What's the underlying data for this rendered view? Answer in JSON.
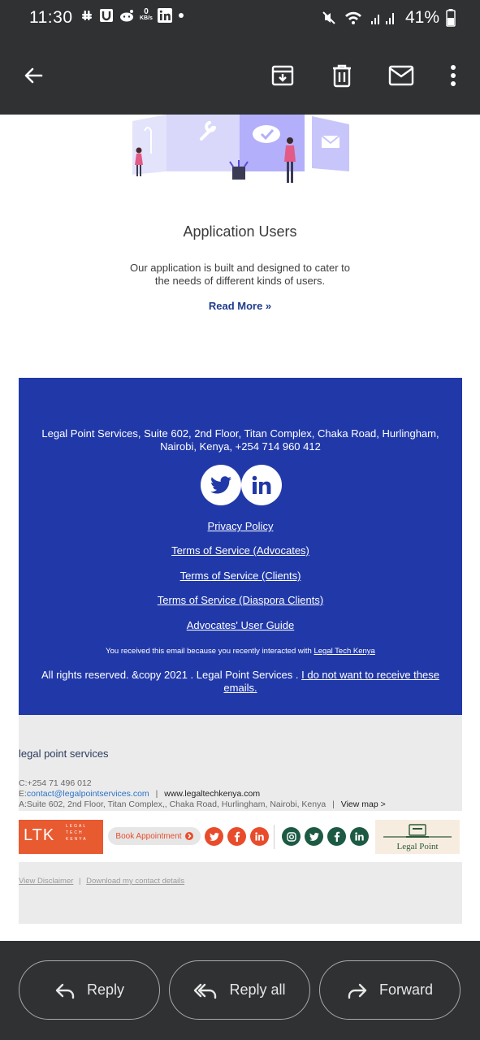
{
  "status_bar": {
    "time": "11:30",
    "net_speed_value": "0",
    "net_speed_unit": "KB/s",
    "battery": "41%"
  },
  "toolbar": {
    "back_icon": "arrow-left-icon",
    "archive_icon": "archive-icon",
    "delete_icon": "trash-icon",
    "mail_icon": "mail-icon",
    "more_icon": "more-vert-icon"
  },
  "section": {
    "title": "Application Users",
    "description": "Our application is built and designed to cater to the needs of different kinds of users.",
    "read_more": "Read More »"
  },
  "footer": {
    "address": "Legal Point Services, Suite 602, 2nd Floor, Titan Complex, Chaka Road, Hurlingham, Nairobi, Kenya, +254 714 960 412",
    "links": [
      "Privacy Policy",
      "Terms of Service (Advocates)",
      "Terms of Service (Clients)",
      "Terms of Service (Diaspora Clients)",
      "Advocates' User Guide"
    ],
    "notice_prefix": "You received this email because you recently interacted with",
    "notice_link": "Legal Tech Kenya",
    "rights_prefix": "All rights reserved. &copy 2021 . Legal Point Services .",
    "rights_link": "I do not want to receive these emails."
  },
  "signature": {
    "name": "legal point services",
    "phone": "C:+254 71 496 012",
    "email_prefix": "E:",
    "email": "contact@legalpointservices.com",
    "website": "www.legaltechkenya.com",
    "address": "A:Suite 602, 2nd Floor, Titan Complex,, Chaka Road, Hurlingham, Nairobi, Kenya",
    "view_map": "View map >",
    "separator": "|"
  },
  "banner": {
    "ltk_big": "LTK",
    "ltk_small_1": "LEGAL",
    "ltk_small_2": "TECH",
    "ltk_small_3": "KENYA",
    "book_label": "Book Appointment",
    "legal_point_label": "Legal Point"
  },
  "sig_footer": {
    "disclaimer": "View Disclaimer",
    "download": "Download my contact details"
  },
  "actions": {
    "reply": "Reply",
    "reply_all": "Reply all",
    "forward": "Forward"
  },
  "colors": {
    "footer_blue": "#2139a8",
    "read_more": "#1f3b8d",
    "ltk_orange": "#e85a30",
    "social_green": "#1c5a43"
  }
}
